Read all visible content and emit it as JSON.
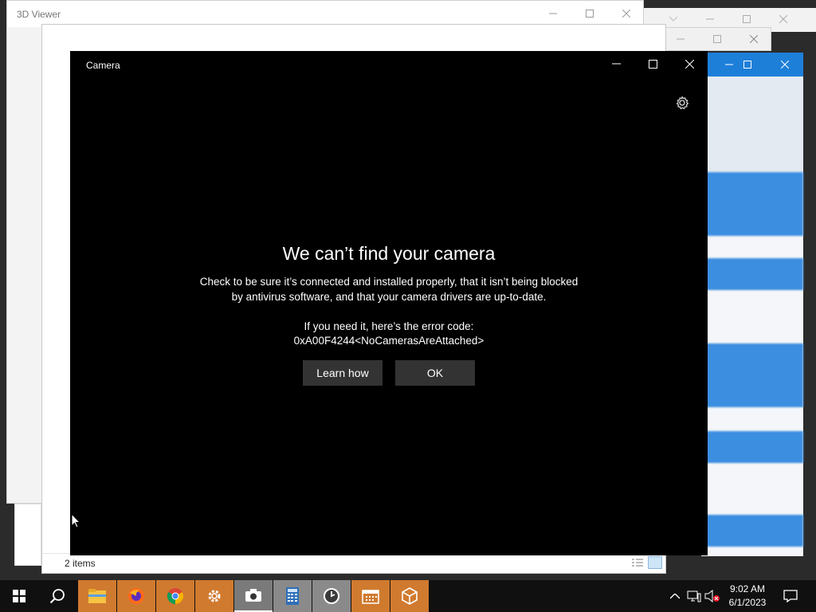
{
  "background": {
    "viewer_title": "3D Viewer",
    "explorer_status": "2 items"
  },
  "camera": {
    "window_title": "Camera",
    "error": {
      "title": "We can’t find your camera",
      "line1": "Check to be sure it’s connected and installed properly, that it isn’t being blocked",
      "line2": "by antivirus software, and that your camera drivers are up-to-date.",
      "code_label": "If you need it, here’s the error code:",
      "code": "0xA00F4244<NoCamerasAreAttached>"
    },
    "learn_how_label": "Learn how",
    "ok_label": "OK"
  },
  "taskbar": {
    "apps": [
      "start-icon",
      "search-icon",
      "file-explorer-icon",
      "firefox-icon",
      "chrome-icon",
      "settings-icon",
      "camera-icon",
      "calculator-icon",
      "alarms-icon",
      "calendar-icon",
      "3d-viewer-icon"
    ],
    "time": "9:02 AM",
    "date": "6/1/2023"
  },
  "colors": {
    "accent": "#d07a2f",
    "camera_bg": "#000000",
    "button_bg": "#333333"
  }
}
